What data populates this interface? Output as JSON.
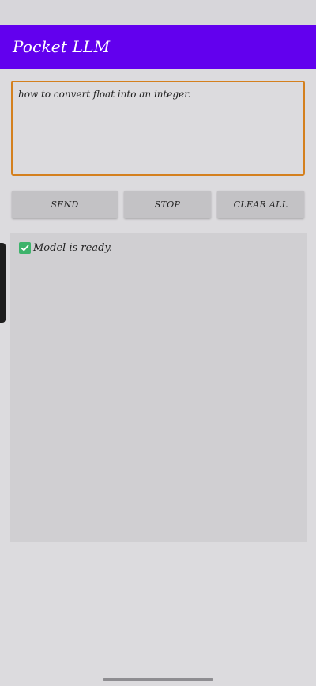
{
  "app": {
    "title": "Pocket LLM"
  },
  "prompt": {
    "value": "how to convert float into an integer."
  },
  "buttons": {
    "send": "SEND",
    "stop": "STOP",
    "clear_all": "CLEAR ALL"
  },
  "output": {
    "status_icon": "check-icon",
    "status_text": "Model is ready."
  },
  "colors": {
    "app_bar": "#6200ee",
    "input_border": "#d4801e",
    "check": "#3db36b",
    "background": "#dcdbde"
  }
}
